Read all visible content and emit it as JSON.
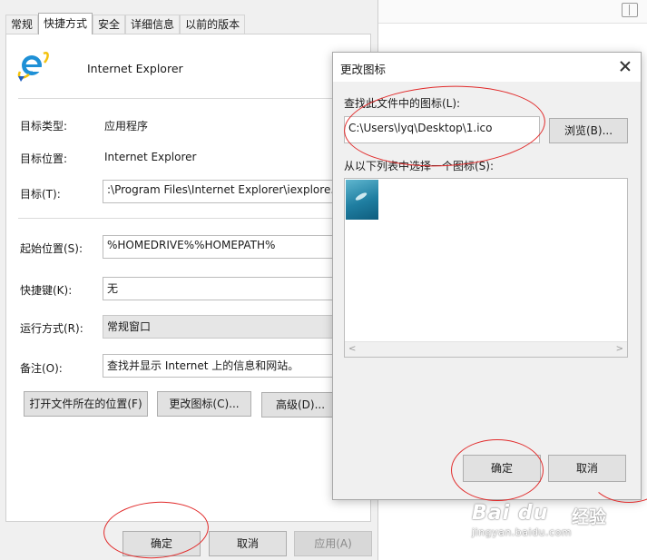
{
  "props": {
    "tabs": [
      "常规",
      "快捷方式",
      "安全",
      "详细信息",
      "以前的版本"
    ],
    "active_tab": "快捷方式",
    "app_name": "Internet Explorer",
    "labels": {
      "target_type": "目标类型:",
      "target_location": "目标位置:",
      "target": "目标(T):",
      "start_in": "起始位置(S):",
      "shortcut_key": "快捷键(K):",
      "run": "运行方式(R):",
      "comment": "备注(O):"
    },
    "values": {
      "target_type": "应用程序",
      "target_location": "Internet Explorer",
      "target": ":\\Program Files\\Internet Explorer\\iexplore.e",
      "start_in": "%HOMEDRIVE%%HOMEPATH%",
      "shortcut_key": "无",
      "run": "常规窗口",
      "comment": "查找并显示 Internet 上的信息和网站。"
    },
    "buttons": {
      "open_location": "打开文件所在的位置(F)",
      "change_icon": "更改图标(C)...",
      "advanced": "高级(D)...",
      "ok": "确定",
      "cancel": "取消",
      "apply": "应用(A)"
    }
  },
  "dialog": {
    "title": "更改图标",
    "find_label": "查找此文件中的图标(L):",
    "path": "C:\\Users\\lyq\\Desktop\\1.ico",
    "browse": "浏览(B)...",
    "list_label": "从以下列表中选择一个图标(S):",
    "ok": "确定",
    "cancel": "取消"
  },
  "watermark": {
    "logo": "Bai du",
    "cn": "经验",
    "sub": "jingyan.baidu.com"
  },
  "colors": {
    "annotation": "#e12a2a",
    "ie_blue": "#1e90d6",
    "ie_yellow": "#f4c20d"
  }
}
